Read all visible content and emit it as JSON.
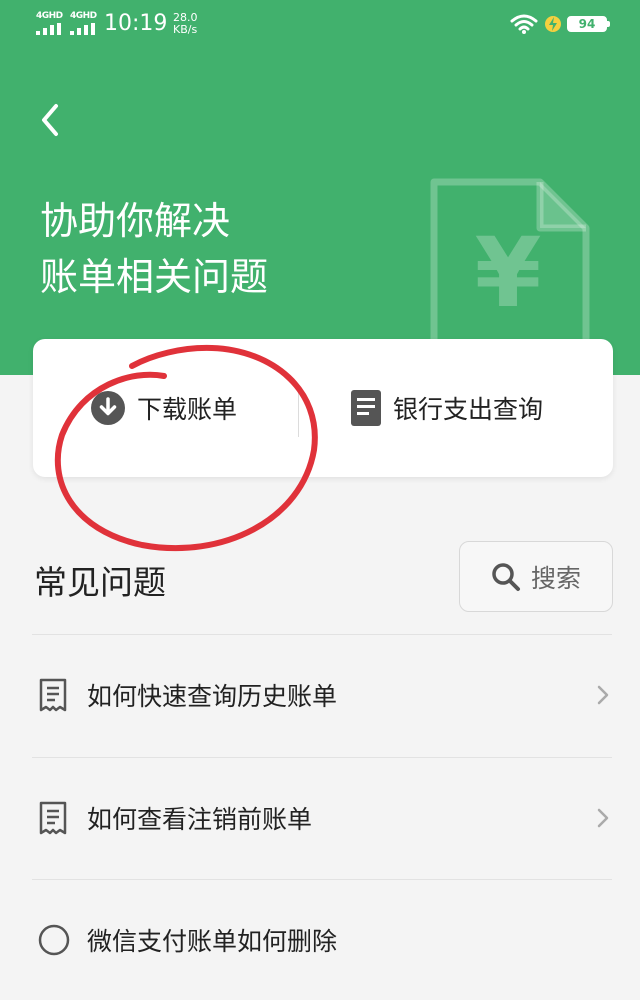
{
  "status_bar": {
    "network_1": "4GHD",
    "network_2": "4GHD",
    "time": "10:19",
    "speed_value": "28.0",
    "speed_unit": "KB/s",
    "battery": "94"
  },
  "header": {
    "title_line1": "协助你解决",
    "title_line2": "账单相关问题",
    "decor_symbol": "¥",
    "color": "#41b16d"
  },
  "actions": {
    "download": {
      "label": "下载账单",
      "icon": "download-circle-icon"
    },
    "bank": {
      "label": "银行支出查询",
      "icon": "document-icon"
    }
  },
  "faq": {
    "title": "常见问题",
    "search_label": "搜索",
    "items": [
      {
        "label": "如何快速查询历史账单",
        "icon": "receipt-icon"
      },
      {
        "label": "如何查看注销前账单",
        "icon": "receipt-icon"
      },
      {
        "label": "微信支付账单如何删除",
        "icon": "help-circle-icon"
      }
    ]
  },
  "annotation_color": "#e0323a"
}
